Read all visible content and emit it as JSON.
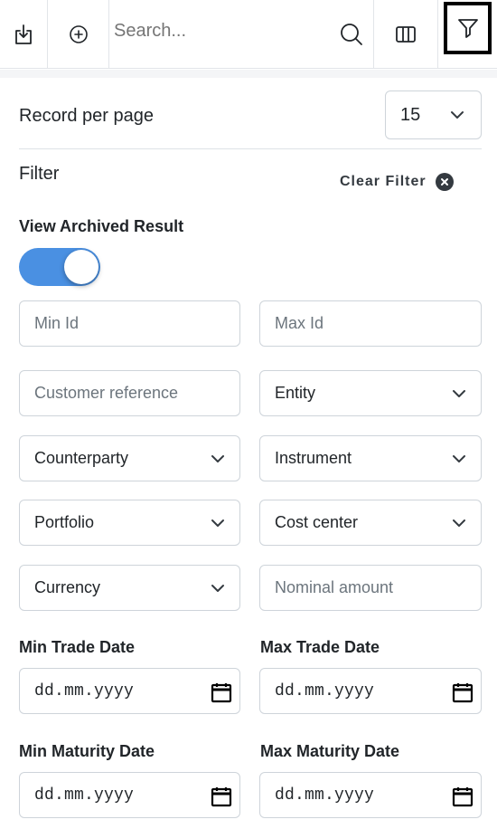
{
  "toolbar": {
    "download_icon": "download-icon",
    "add_icon": "plus-circle-icon",
    "search_placeholder": "Search...",
    "search_icon": "search-icon",
    "columns_icon": "columns-icon",
    "filter_icon": "filter-icon"
  },
  "records": {
    "label": "Record per page",
    "value": "15"
  },
  "filter": {
    "title": "Filter",
    "clear_label": "Clear Filter"
  },
  "archived": {
    "label": "View Archived Result",
    "enabled": true
  },
  "fields": {
    "min_id": "Min Id",
    "max_id": "Max Id",
    "customer_reference": "Customer reference",
    "entity": "Entity",
    "counterparty": "Counterparty",
    "instrument": "Instrument",
    "portfolio": "Portfolio",
    "cost_center": "Cost center",
    "currency": "Currency",
    "nominal_amount": "Nominal amount"
  },
  "dates": {
    "min_trade_label": "Min Trade Date",
    "max_trade_label": "Max Trade Date",
    "min_maturity_label": "Min Maturity Date",
    "max_maturity_label": "Max Maturity Date",
    "placeholder": "dd.mm.yyyy"
  },
  "colors": {
    "toggle_on": "#4a90e2",
    "border": "#ced4da"
  }
}
